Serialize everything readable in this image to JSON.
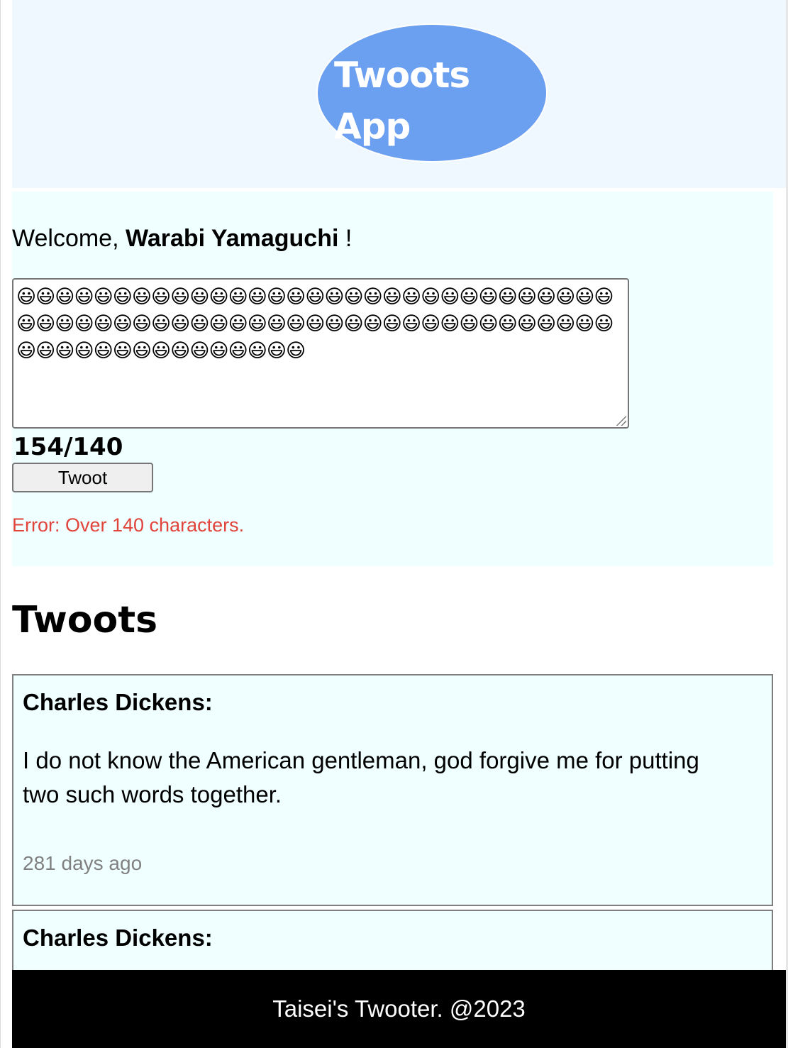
{
  "header": {
    "logo_text": "Twoots App",
    "logo_color": "#6b9ff0",
    "background": "#f0f8ff"
  },
  "compose": {
    "welcome_prefix": "Welcome,",
    "user_name": "Warabi Yamaguchi",
    "welcome_suffix": "!",
    "draft_text": "😃😃😃😃😃😃😃😃😃😃😃😃😃😃😃😃😃😃😃😃😃😃😃😃😃😃😃😃😃😃😃😃😃😃😃😃😃😃😃😃😃😃😃😃😃😃😃😃😃😃😃😃😃😃😃😃😃😃😃😃😃😃😃😃😃😃😃😃😃😃😃😃😃😃😃😃😃",
    "char_count": "154/140",
    "submit_label": "Twoot",
    "error_text": "Error: Over 140 characters.",
    "error_color": "#e0443b"
  },
  "feed": {
    "title": "Twoots",
    "twoots": [
      {
        "author": "Charles Dickens:",
        "body": "I do not know the American gentleman, god forgive me for putting two such words together.",
        "time": "281 days ago"
      },
      {
        "author": "Charles Dickens:"
      }
    ]
  },
  "footer": {
    "text": "Taisei's Twooter. @2023"
  }
}
